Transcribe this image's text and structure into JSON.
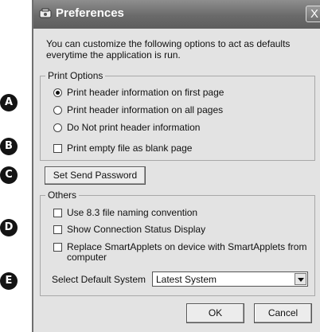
{
  "window": {
    "title": "Preferences",
    "close_label": "X"
  },
  "description": "You can customize the following options to act as defaults everytime the application is run.",
  "markers": [
    "A",
    "B",
    "C",
    "D",
    "E"
  ],
  "print_options": {
    "legend": "Print Options",
    "radios": [
      {
        "label": "Print header information on first page",
        "checked": true
      },
      {
        "label": "Print header information on all pages",
        "checked": false
      },
      {
        "label": "Do Not print header information",
        "checked": false
      }
    ],
    "blank_page_label": "Print empty file as blank page"
  },
  "send_password_button": "Set Send Password",
  "others": {
    "legend": "Others",
    "checks": [
      {
        "label": "Use 8.3 file naming convention"
      },
      {
        "label": "Show Connection Status Display"
      },
      {
        "label": "Replace SmartApplets on device with SmartApplets from computer"
      }
    ],
    "default_system_label": "Select Default System",
    "default_system_value": "Latest System"
  },
  "buttons": {
    "ok": "OK",
    "cancel": "Cancel"
  }
}
